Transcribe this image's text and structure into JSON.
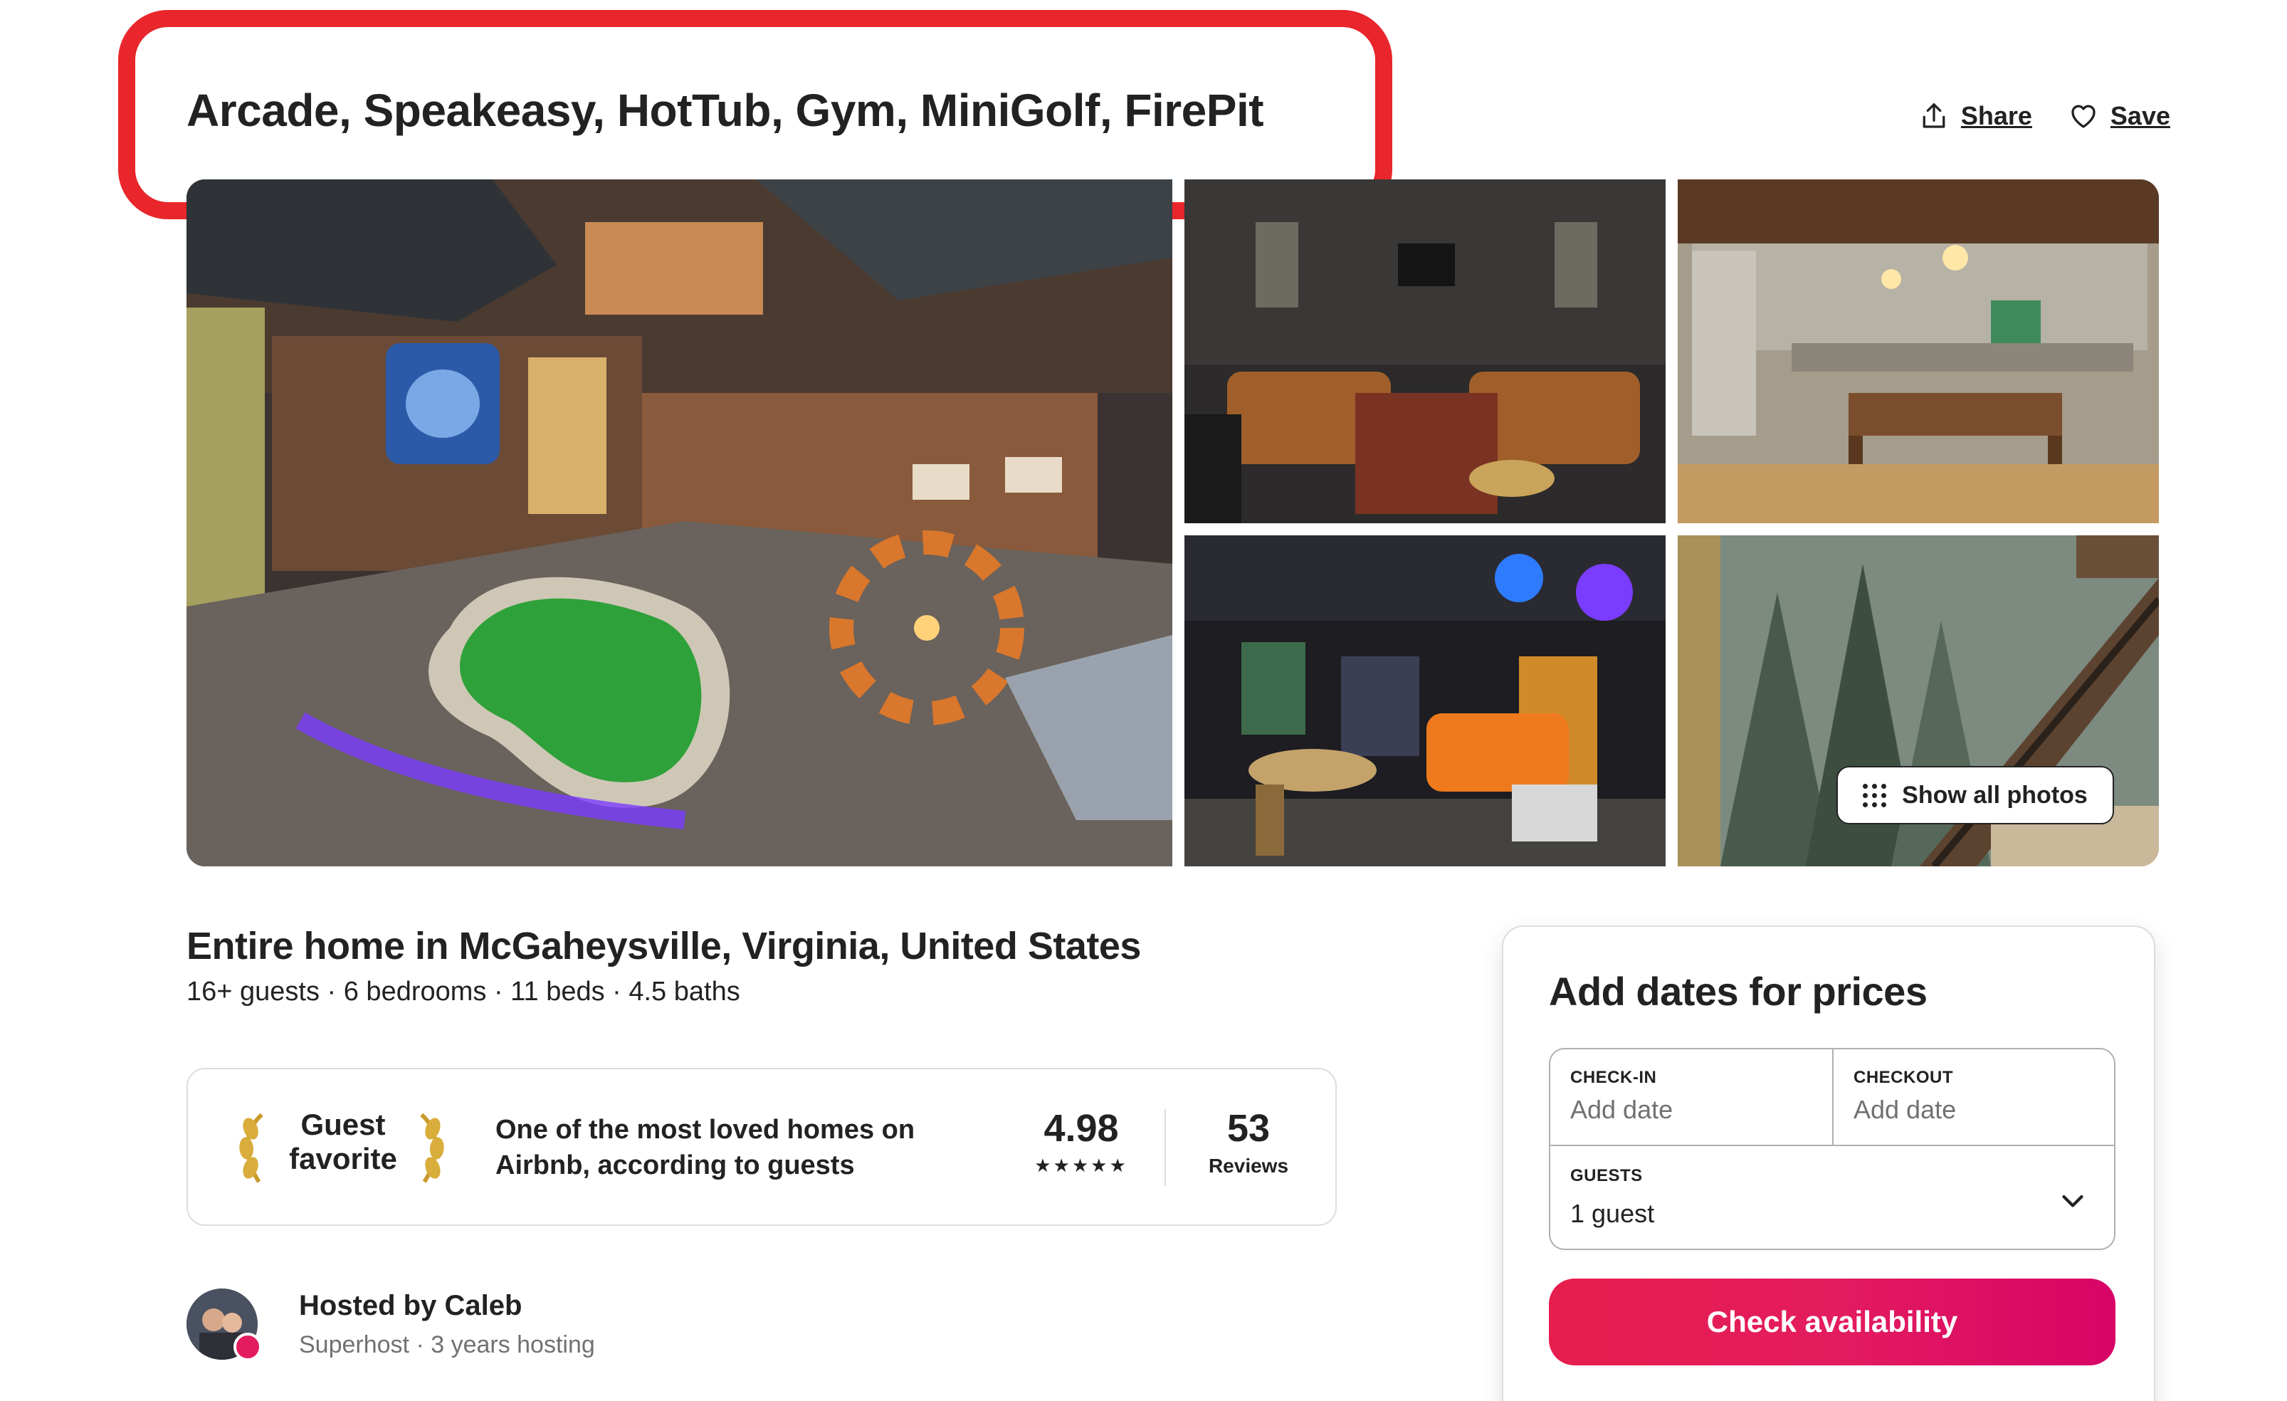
{
  "listing": {
    "title": "Arcade, Speakeasy, HotTub, Gym, MiniGolf, FirePit",
    "share_label": "Share",
    "save_label": "Save"
  },
  "gallery": {
    "show_all_label": "Show all photos"
  },
  "summary": {
    "location_title": "Entire home in McGaheysville, Virginia, United States",
    "details": "16+ guests · 6 bedrooms · 11 beds · 4.5 baths"
  },
  "guest_favorite": {
    "badge_line1": "Guest",
    "badge_line2": "favorite",
    "description_line1": "One of the most loved homes on",
    "description_line2": "Airbnb, according to guests",
    "rating": "4.98",
    "stars": "★★★★★",
    "review_count": "53",
    "reviews_label": "Reviews"
  },
  "host": {
    "name_line": "Hosted by Caleb",
    "sub_line": "Superhost · 3 years hosting"
  },
  "booking": {
    "title": "Add dates for prices",
    "checkin_label": "CHECK-IN",
    "checkin_value": "Add date",
    "checkout_label": "CHECKOUT",
    "checkout_value": "Add date",
    "guests_label": "GUESTS",
    "guests_value": "1 guest",
    "cta_label": "Check availability"
  },
  "colors": {
    "annotation_box": "#e8262b",
    "cta_gradient_start": "#e61e4d",
    "cta_gradient_end": "#d70466",
    "text_primary": "#222222",
    "text_secondary": "#717171",
    "border": "#dddddd"
  }
}
